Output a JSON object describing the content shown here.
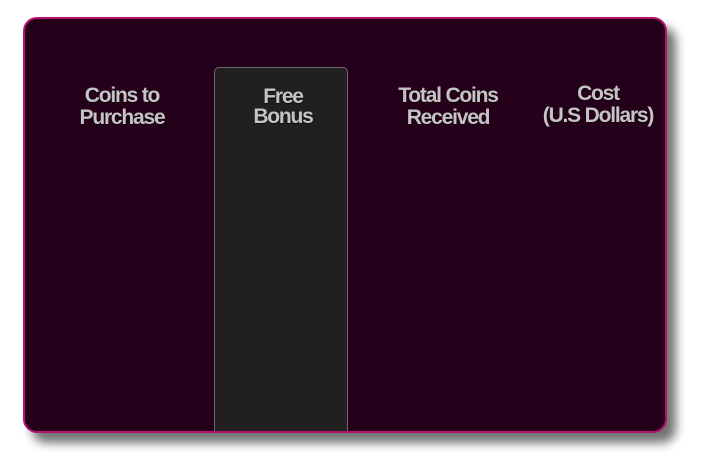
{
  "table": {
    "columns": [
      {
        "line1": "Coins to",
        "line2": "Purchase"
      },
      {
        "line1": "Free",
        "line2": "Bonus"
      },
      {
        "line1": "Total Coins",
        "line2": "Received"
      },
      {
        "line1": "Cost",
        "line2": "(U.S Dollars)"
      }
    ]
  },
  "colors": {
    "panel_background": "#25001a",
    "panel_border": "#b3126f",
    "highlight_column": "#211f20",
    "header_text": "#c4c4c4"
  }
}
